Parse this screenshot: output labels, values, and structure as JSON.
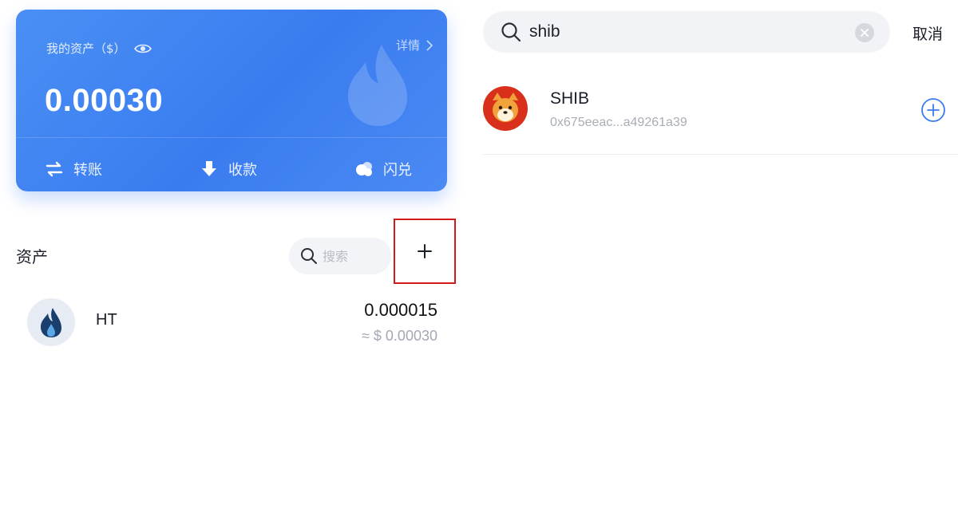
{
  "wallet_card": {
    "label": "我的资产（$）",
    "details_label": "详情",
    "balance": "0.00030",
    "actions": [
      "转账",
      "收款",
      "闪兑"
    ]
  },
  "assets": {
    "title": "资产",
    "search_placeholder": "搜索",
    "items": [
      {
        "name": "HT",
        "amount": "0.000015",
        "value": "≈ $ 0.00030"
      }
    ]
  },
  "token_search": {
    "query": "shib",
    "cancel_label": "取消",
    "results": [
      {
        "symbol": "SHIB",
        "address": "0x675eeac...a49261a39"
      }
    ]
  }
}
